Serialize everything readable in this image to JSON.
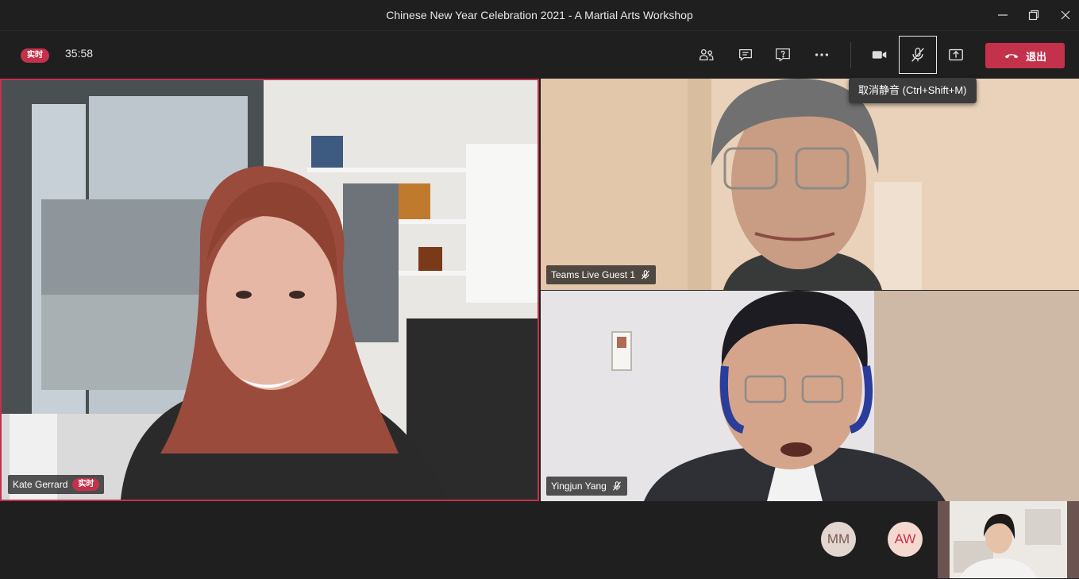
{
  "window": {
    "title": "Chinese New Year Celebration 2021 - A Martial Arts Workshop"
  },
  "toolbar": {
    "live_label": "实时",
    "timer": "35:58",
    "leave_label": "退出",
    "mute_tooltip": "取消静音 (Ctrl+Shift+M)"
  },
  "participants": {
    "main": {
      "name": "Kate Gerrard",
      "live_label": "实时"
    },
    "top_right": {
      "name": "Teams Live Guest 1"
    },
    "bottom_right": {
      "name": "Yingjun Yang"
    },
    "avatars": [
      {
        "initials": "MM"
      },
      {
        "initials": "AW"
      }
    ]
  },
  "colors": {
    "accent_red": "#c4314b",
    "background": "#1f1f1f"
  },
  "icons": [
    "minimize-icon",
    "restore-icon",
    "close-icon",
    "participants-icon",
    "chat-icon",
    "raise-hand-icon",
    "more-icon",
    "camera-icon",
    "mic-off-icon",
    "share-screen-icon",
    "hang-up-icon"
  ]
}
